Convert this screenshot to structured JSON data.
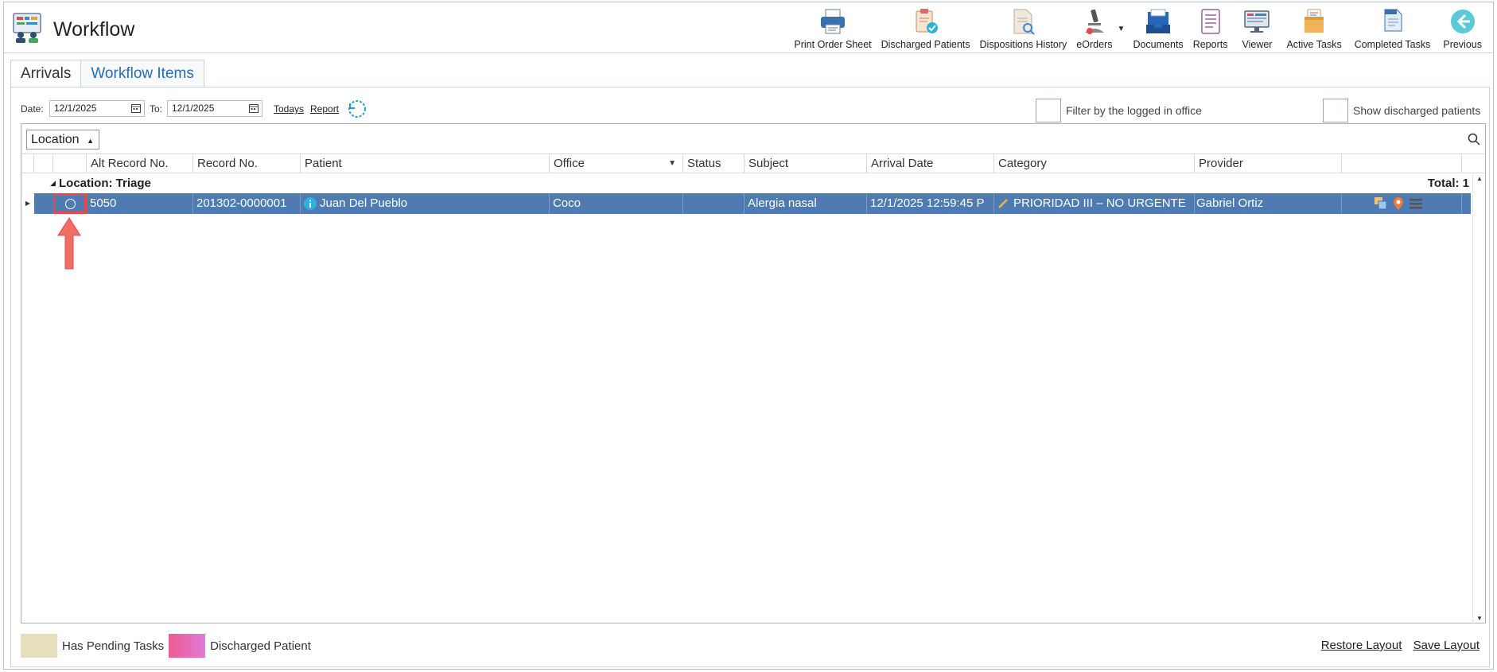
{
  "app": {
    "title": "Workflow"
  },
  "toolbar": {
    "items": [
      {
        "label": "Print Order Sheet",
        "icon": "printer-icon"
      },
      {
        "label": "Discharged Patients",
        "icon": "clipboard-check-icon"
      },
      {
        "label": "Dispositions History",
        "icon": "document-search-icon"
      },
      {
        "label": "eOrders",
        "icon": "microscope-icon"
      },
      {
        "label": "Documents",
        "icon": "inbox-tray-icon"
      },
      {
        "label": "Reports",
        "icon": "report-list-icon"
      },
      {
        "label": "Viewer",
        "icon": "monitor-icon"
      },
      {
        "label": "Active Tasks",
        "icon": "task-box-icon"
      },
      {
        "label": "Completed Tasks",
        "icon": "completed-document-icon"
      },
      {
        "label": "Previous",
        "icon": "back-arrow-icon"
      }
    ]
  },
  "tabs": [
    {
      "label": "Arrivals",
      "active": true
    },
    {
      "label": "Workflow Items",
      "active": false
    }
  ],
  "filters": {
    "date_label": "Date:",
    "date_from": "12/1/2025",
    "to_label": "To:",
    "date_to": "12/1/2025",
    "todays": "Todays",
    "report": "Report",
    "filter_office": "Filter by the logged in office",
    "show_discharged": "Show discharged patients"
  },
  "grid": {
    "group_by": "Location",
    "columns": [
      "Alt Record No.",
      "Record No.",
      "Patient",
      "Office",
      "Status",
      "Subject",
      "Arrival Date",
      "Category",
      "Provider"
    ],
    "group": {
      "title": "Location: Triage",
      "total": "Total: 1"
    },
    "rows": [
      {
        "alt_record": "5050",
        "record": "201302-0000001",
        "patient": "Juan Del Pueblo",
        "office": "Coco",
        "status": "",
        "subject": "Alergia nasal",
        "arrival_date": "12/1/2025 12:59:45 P",
        "category": "PRIORIDAD III – NO URGENTE",
        "provider": "Gabriel Ortiz"
      }
    ]
  },
  "legend": {
    "pending": {
      "label": "Has Pending Tasks",
      "color": "#e8e0bd"
    },
    "discharged": {
      "label": "Discharged Patient",
      "color": "#e56fb0"
    }
  },
  "footer": {
    "restore": "Restore Layout",
    "save": "Save Layout"
  },
  "colors": {
    "selected_row": "#4f7bb3",
    "highlight": "#e5484d",
    "accent": "#2b6cb0"
  }
}
